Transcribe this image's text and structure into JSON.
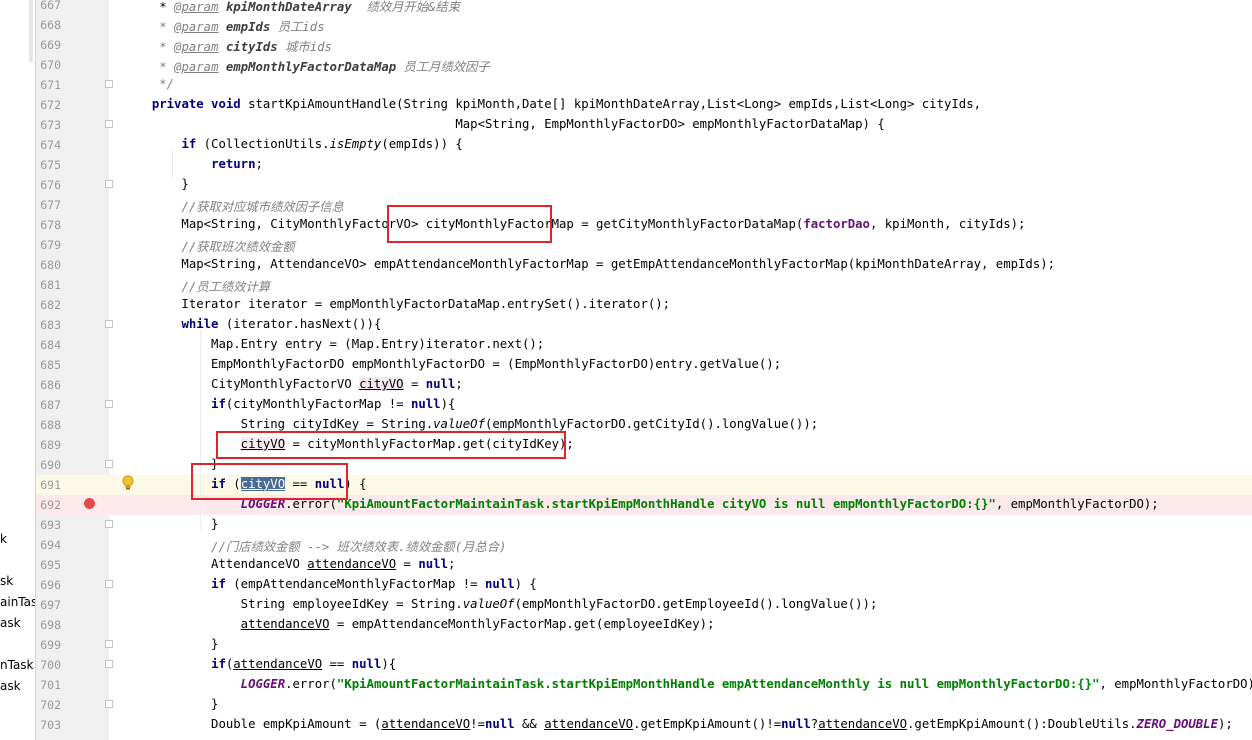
{
  "left_panel": {
    "items": [
      "k",
      "sk",
      "ainTas",
      "ask",
      "nTask",
      "ask"
    ]
  },
  "editor": {
    "lines": [
      {
        "num": "667",
        "tokens": [
          [
            "        * ",
            ""
          ],
          [
            "@param",
            "tag"
          ],
          [
            " ",
            ""
          ],
          [
            "kpiMonthDateArray",
            "pn"
          ],
          [
            "  绩效月开始&结束",
            "cm"
          ]
        ]
      },
      {
        "num": "668",
        "tokens": [
          [
            "        * ",
            "cm"
          ],
          [
            "@param",
            "tag"
          ],
          [
            " ",
            ""
          ],
          [
            "empIds",
            "pn"
          ],
          [
            " 员工ids",
            "cm"
          ]
        ]
      },
      {
        "num": "669",
        "tokens": [
          [
            "        * ",
            "cm"
          ],
          [
            "@param",
            "tag"
          ],
          [
            " ",
            ""
          ],
          [
            "cityIds",
            "pn"
          ],
          [
            " 城市ids",
            "cm"
          ]
        ]
      },
      {
        "num": "670",
        "tokens": [
          [
            "        * ",
            "cm"
          ],
          [
            "@param",
            "tag"
          ],
          [
            " ",
            ""
          ],
          [
            "empMonthlyFactorDataMap",
            "pn"
          ],
          [
            " 员工月绩效因子",
            "cm"
          ]
        ]
      },
      {
        "num": "671",
        "tokens": [
          [
            "        */",
            "cm"
          ]
        ]
      },
      {
        "num": "672",
        "tokens": [
          [
            "       ",
            ""
          ],
          [
            "private void",
            "kw"
          ],
          [
            " startKpiAmountHandle(String kpiMonth,Date[] kpiMonthDateArray,List<Long> empIds,List<Long> cityIds,",
            ""
          ]
        ]
      },
      {
        "num": "673",
        "tokens": [
          [
            "                                                Map<String, EmpMonthlyFactorDO> empMonthlyFactorDataMap) {",
            ""
          ]
        ]
      },
      {
        "num": "674",
        "tokens": [
          [
            "           ",
            ""
          ],
          [
            "if",
            "kw"
          ],
          [
            " (CollectionUtils.",
            ""
          ],
          [
            "isEmpty",
            "st"
          ],
          [
            "(empIds)) {",
            ""
          ]
        ]
      },
      {
        "num": "675",
        "tokens": [
          [
            "               ",
            ""
          ],
          [
            "return",
            "kw"
          ],
          [
            ";",
            ""
          ]
        ]
      },
      {
        "num": "676",
        "tokens": [
          [
            "           }",
            ""
          ]
        ]
      },
      {
        "num": "677",
        "tokens": [
          [
            "           //获取对应城市绩效因子信息",
            "cm"
          ]
        ]
      },
      {
        "num": "678",
        "tokens": [
          [
            "           Map<String, CityMonthlyFactorVO> cityMonthlyFactorMap = getCityMonthlyFactorDataMap(",
            ""
          ],
          [
            "factorDao",
            "fld"
          ],
          [
            ", kpiMonth, cityIds);",
            ""
          ]
        ]
      },
      {
        "num": "679",
        "tokens": [
          [
            "           //获取班次绩效金额",
            "cm"
          ]
        ]
      },
      {
        "num": "680",
        "tokens": [
          [
            "           Map<String, AttendanceVO> empAttendanceMonthlyFactorMap = getEmpAttendanceMonthlyFactorMap(kpiMonthDateArray, empIds);",
            ""
          ]
        ]
      },
      {
        "num": "681",
        "tokens": [
          [
            "           //员工绩效计算",
            "cm"
          ]
        ]
      },
      {
        "num": "682",
        "tokens": [
          [
            "           Iterator iterator = empMonthlyFactorDataMap.entrySet().iterator();",
            ""
          ]
        ]
      },
      {
        "num": "683",
        "tokens": [
          [
            "           ",
            ""
          ],
          [
            "while",
            "kw"
          ],
          [
            " (iterator.hasNext()){",
            ""
          ]
        ]
      },
      {
        "num": "684",
        "tokens": [
          [
            "               Map.Entry entry = (Map.Entry)iterator.next();",
            ""
          ]
        ]
      },
      {
        "num": "685",
        "tokens": [
          [
            "               EmpMonthlyFactorDO empMonthlyFactorDO = (EmpMonthlyFactorDO)entry.getValue();",
            ""
          ]
        ]
      },
      {
        "num": "686",
        "tokens": [
          [
            "               CityMonthlyFactorVO ",
            ""
          ],
          [
            "cityVO",
            "hl"
          ],
          [
            " = ",
            ""
          ],
          [
            "null",
            "kw"
          ],
          [
            ";",
            ""
          ]
        ]
      },
      {
        "num": "687",
        "tokens": [
          [
            "               ",
            ""
          ],
          [
            "if",
            "kw"
          ],
          [
            "(cityMonthlyFactorMap != ",
            ""
          ],
          [
            "null",
            "kw"
          ],
          [
            "){",
            ""
          ]
        ]
      },
      {
        "num": "688",
        "tokens": [
          [
            "                   String cityIdKey = String.",
            ""
          ],
          [
            "valueOf",
            "st"
          ],
          [
            "(empMonthlyFactorDO.getCityId().longValue());",
            ""
          ]
        ]
      },
      {
        "num": "689",
        "tokens": [
          [
            "                   ",
            ""
          ],
          [
            "cityVO",
            "hl"
          ],
          [
            " = cityMonthlyFactorMap.get(cityIdKey);",
            ""
          ]
        ]
      },
      {
        "num": "690",
        "tokens": [
          [
            "               }",
            ""
          ]
        ]
      },
      {
        "num": "691",
        "tokens": [
          [
            "               ",
            ""
          ],
          [
            "if",
            "kw"
          ],
          [
            " (",
            ""
          ],
          [
            "cityVO",
            "ul-sel"
          ],
          [
            " == ",
            ""
          ],
          [
            "null",
            "kw"
          ],
          [
            ") {",
            ""
          ]
        ]
      },
      {
        "num": "692",
        "tokens": [
          [
            "                   ",
            ""
          ],
          [
            "LOGGER",
            "fldi"
          ],
          [
            ".error(",
            ""
          ],
          [
            "\"KpiAmountFactorMaintainTask.startKpiEmpMonthHandle cityVO is null empMonthlyFactorDO:{}\"",
            "str"
          ],
          [
            ", empMonthlyFactorDO);",
            ""
          ]
        ]
      },
      {
        "num": "693",
        "tokens": [
          [
            "               }",
            ""
          ]
        ]
      },
      {
        "num": "694",
        "tokens": [
          [
            "               //门店绩效金额 --> 班次绩效表.绩效金额(月总合)",
            "cm"
          ]
        ]
      },
      {
        "num": "695",
        "tokens": [
          [
            "               AttendanceVO ",
            ""
          ],
          [
            "attendanceVO",
            "ul"
          ],
          [
            " = ",
            ""
          ],
          [
            "null",
            "kw"
          ],
          [
            ";",
            ""
          ]
        ]
      },
      {
        "num": "696",
        "tokens": [
          [
            "               ",
            ""
          ],
          [
            "if",
            "kw"
          ],
          [
            " (empAttendanceMonthlyFactorMap != ",
            ""
          ],
          [
            "null",
            "kw"
          ],
          [
            ") {",
            ""
          ]
        ]
      },
      {
        "num": "697",
        "tokens": [
          [
            "                   String employeeIdKey = String.",
            ""
          ],
          [
            "valueOf",
            "st"
          ],
          [
            "(empMonthlyFactorDO.getEmployeeId().longValue());",
            ""
          ]
        ]
      },
      {
        "num": "698",
        "tokens": [
          [
            "                   ",
            ""
          ],
          [
            "attendanceVO",
            "ul"
          ],
          [
            " = empAttendanceMonthlyFactorMap.get(employeeIdKey);",
            ""
          ]
        ]
      },
      {
        "num": "699",
        "tokens": [
          [
            "               }",
            ""
          ]
        ]
      },
      {
        "num": "700",
        "tokens": [
          [
            "               ",
            ""
          ],
          [
            "if",
            "kw"
          ],
          [
            "(",
            ""
          ],
          [
            "attendanceVO",
            "ul"
          ],
          [
            " == ",
            ""
          ],
          [
            "null",
            "kw"
          ],
          [
            "){",
            ""
          ]
        ]
      },
      {
        "num": "701",
        "tokens": [
          [
            "                   ",
            ""
          ],
          [
            "LOGGER",
            "fldi"
          ],
          [
            ".error(",
            ""
          ],
          [
            "\"KpiAmountFactorMaintainTask.startKpiEmpMonthHandle empAttendanceMonthly is null empMonthlyFactorDO:{}\"",
            "str"
          ],
          [
            ", empMonthlyFactorDO);",
            ""
          ]
        ]
      },
      {
        "num": "702",
        "tokens": [
          [
            "               }",
            ""
          ]
        ]
      },
      {
        "num": "703",
        "tokens": [
          [
            "               Double empKpiAmount = (",
            ""
          ],
          [
            "attendanceVO",
            "ul"
          ],
          [
            "!=",
            ""
          ],
          [
            "null",
            "kw"
          ],
          [
            " && ",
            ""
          ],
          [
            "attendanceVO",
            "ul"
          ],
          [
            ".getEmpKpiAmount()!=",
            ""
          ],
          [
            "null",
            "kw"
          ],
          [
            "?",
            ""
          ],
          [
            "attendanceVO",
            "ul"
          ],
          [
            ".getEmpKpiAmount():DoubleUtils.",
            ""
          ],
          [
            "ZERO_DOUBLE",
            "fldi"
          ],
          [
            ");",
            ""
          ]
        ]
      }
    ]
  },
  "gutter": {
    "breakpoint_line": "692",
    "current_line": "691",
    "bulb_line": "691",
    "folds": [
      "671",
      "673",
      "676",
      "683",
      "687",
      "690",
      "693",
      "696",
      "699",
      "700",
      "702"
    ]
  }
}
